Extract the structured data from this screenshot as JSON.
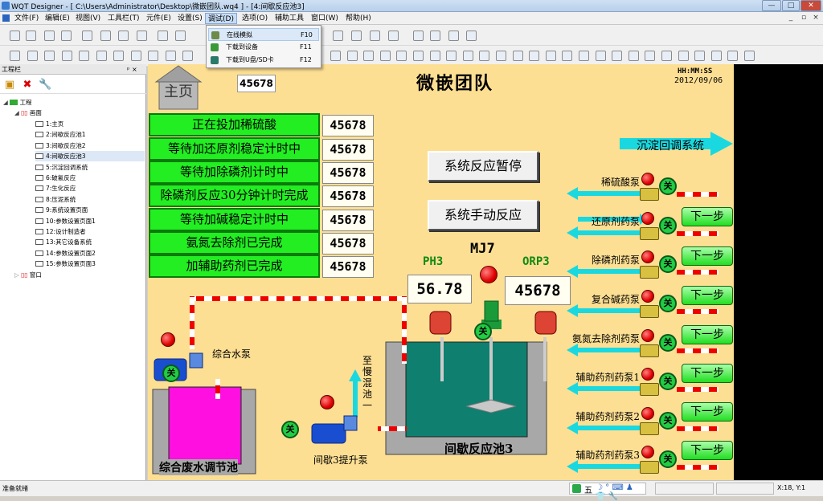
{
  "window": {
    "title": "WQT Designer - [ C:\\Users\\Administrator\\Desktop\\微嵌团队.wq4 ] - [4:间歇反应池3]",
    "min": "—",
    "max": "□",
    "close": "✕"
  },
  "menu": [
    "文件(F)",
    "编辑(E)",
    "视图(V)",
    "工具栏(T)",
    "元件(E)",
    "设置(S)",
    "调试(D)",
    "选项(O)",
    "辅助工具",
    "窗口(W)",
    "帮助(H)"
  ],
  "dropdown": [
    {
      "label": "在线模拟",
      "key": "F10"
    },
    {
      "label": "下载到设备",
      "key": "F11"
    },
    {
      "label": "下载到U盘/SD卡",
      "key": "F12"
    }
  ],
  "panel": {
    "title": "工程栏",
    "pin": "ᵖ ×",
    "root": "工程",
    "screens_label": "画面",
    "pages": [
      "1:主页",
      "2:间歇反应池1",
      "3:间歇反应池2",
      "4:间歇反应池3",
      "5:沉淀回调系统",
      "6:破氰反应",
      "7:生化反应",
      "8:压泥系统",
      "9:系统设置页面",
      "10:参数设置页面1",
      "12:设计制造者",
      "13:其它设备系统",
      "14:参数设置页面2",
      "15:参数设置页面3"
    ],
    "selected_index": 3,
    "window_label": "窗口"
  },
  "screen": {
    "home": "主页",
    "top_value": "45678",
    "title": "微嵌团队",
    "clock": "HH:MM:SS",
    "date": "2012/09/06",
    "status_rows": [
      {
        "label": "正在投加稀硫酸",
        "value": "45678"
      },
      {
        "label": "等待加还原剂稳定计时中",
        "value": "45678"
      },
      {
        "label": "等待加除磷剂计时中",
        "value": "45678"
      },
      {
        "label": "除磷剂反应30分钟计时完成",
        "value": "45678"
      },
      {
        "label": "等待加碱稳定计时中",
        "value": "45678"
      },
      {
        "label": "氨氮去除剂已完成",
        "value": "45678"
      },
      {
        "label": "加辅助药剂已完成",
        "value": "45678"
      }
    ],
    "pause_btn": "系统反应暂停",
    "manual_btn": "系统手动反应",
    "settle_system": "沉淀回调系统",
    "mj": "MJ7",
    "ph_label": "PH3",
    "ph_value": "56.78",
    "orp_label": "ORP3",
    "orp_value": "45678",
    "pumps": [
      "稀硫酸泵",
      "还原剂药泵",
      "除磷剂药泵",
      "复合碱药泵",
      "氨氮去除剂药泵",
      "辅助药剂药泵1",
      "辅助药剂药泵2",
      "辅助药剂药泵3"
    ],
    "next_label": "下一步",
    "off_label": "关",
    "mix_pump": "综合水泵",
    "to_tank": "至慢混池一",
    "lift_pump": "间歇3提升泵",
    "reactor": "间歇反应池3",
    "waste_tank": "综合废水调节池"
  },
  "status": {
    "left": "准备就绪",
    "coord": "X:18, Y:1",
    "ime": "五"
  },
  "colors": {
    "canvas": "#fddf93",
    "green_btn": "#22ee22",
    "water": "#0f7f6f",
    "pink": "#ff10e0"
  }
}
